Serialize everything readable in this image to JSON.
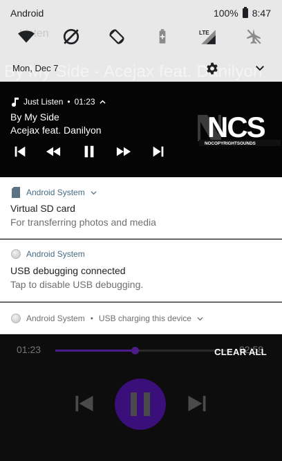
{
  "status": {
    "carrier": "Android",
    "battery": "100%",
    "time": "8:47"
  },
  "quick_settings": {
    "date": "Mon, Dec 7",
    "tiles": [
      "wifi-icon",
      "data-saver-icon",
      "auto-rotate-icon",
      "battery-saver-icon",
      "lte-signal-icon",
      "airplane-mode-icon"
    ],
    "lte_label": "LTE"
  },
  "background_ghost": {
    "listen": "Listen",
    "title": "By My Side - Acejax feat. Danilyon"
  },
  "media": {
    "app": "Just Listen",
    "elapsed": "01:23",
    "separator": "•",
    "title": "By My Side",
    "artist": "Acejax feat. Danilyon",
    "art_text": "NCS",
    "art_subtext": "NOCOPYRIGHTSOUNDS"
  },
  "notifications": [
    {
      "app": "Android System",
      "title": "Virtual SD card",
      "text": "For transferring photos and media"
    },
    {
      "app": "Android System",
      "title": "USB debugging connected",
      "text": "Tap to disable USB debugging."
    },
    {
      "app": "Android System",
      "separator": "•",
      "summary": "USB charging this device"
    }
  ],
  "player": {
    "elapsed": "01:23",
    "duration": "02:58",
    "progress": 0.46,
    "accent": "#4b1c8a"
  },
  "clear_all": "CLEAR ALL"
}
